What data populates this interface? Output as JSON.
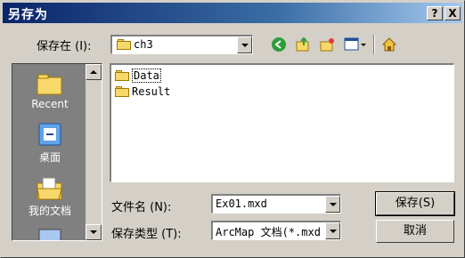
{
  "window": {
    "title": "另存为",
    "help_btn": "?",
    "close_btn": "X"
  },
  "location": {
    "label": "保存在 (I):",
    "value": "ch3"
  },
  "places": [
    {
      "label": "Recent"
    },
    {
      "label": "桌面"
    },
    {
      "label": "我的文档"
    }
  ],
  "files": [
    {
      "name": "Data"
    },
    {
      "name": "Result"
    }
  ],
  "filename": {
    "label": "文件名 (N):",
    "value": "Ex01.mxd"
  },
  "filetype": {
    "label": "保存类型 (T):",
    "value": "ArcMap 文档(*.mxd"
  },
  "buttons": {
    "save": "保存(S)",
    "cancel": "取消"
  }
}
